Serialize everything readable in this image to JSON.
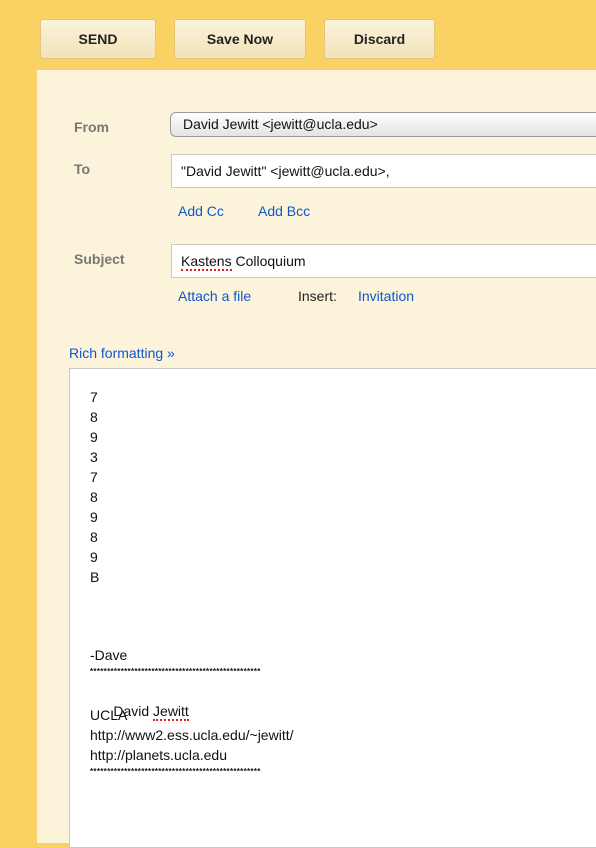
{
  "toolbar": {
    "send_label": "SEND",
    "save_label": "Save Now",
    "discard_label": "Discard"
  },
  "compose": {
    "from_label": "From",
    "from_value": "David Jewitt <jewitt@ucla.edu>",
    "to_label": "To",
    "to_value": "\"David Jewitt\" <jewitt@ucla.edu>,",
    "add_cc": "Add Cc",
    "add_bcc": "Add Bcc",
    "subject_label": "Subject",
    "subject_word1": "Kastens",
    "subject_word2": " Colloquium",
    "attach_file": "Attach a file",
    "insert_label": "Insert:",
    "invitation": "Invitation",
    "rich_formatting": "Rich formatting »"
  },
  "body": {
    "lines": [
      "7",
      "8",
      "9",
      "3",
      "7",
      "8",
      "9",
      "8",
      "9",
      "B"
    ],
    "signoff": "-Dave",
    "stars": "**************************************************",
    "sig_first": "David ",
    "sig_last": "Jewitt",
    "sig_org": "UCLA",
    "sig_url1": "http://www2.ess.ucla.edu/~jewitt/",
    "sig_url2": "http://planets.ucla.edu"
  }
}
